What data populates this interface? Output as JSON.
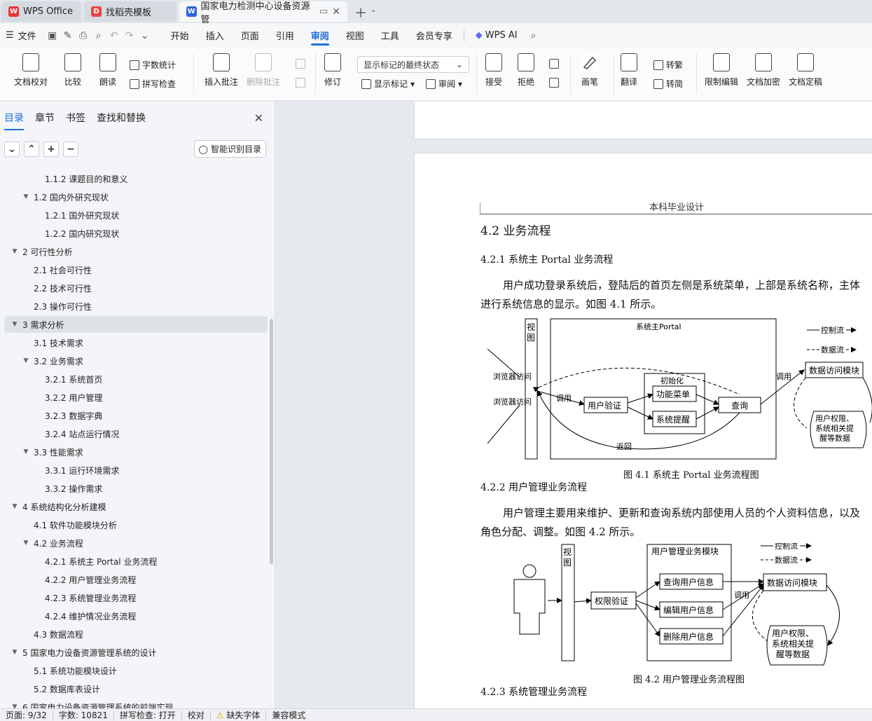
{
  "tabs": [
    {
      "label": "WPS Office"
    },
    {
      "label": "找稻壳模板"
    },
    {
      "label": "国家电力检测中心设备资源管"
    }
  ],
  "menu": {
    "file": "文件",
    "items": [
      "开始",
      "插入",
      "页面",
      "引用",
      "审阅",
      "视图",
      "工具",
      "会员专享"
    ],
    "active": "审阅",
    "ai": "WPS AI"
  },
  "ribbon": {
    "proof": "文档校对",
    "compare": "比较",
    "read": "朗读",
    "wordcount": "字数统计",
    "spell": "拼写检查",
    "insert_comment": "插入批注",
    "delete_comment": "删除批注",
    "revise": "修订",
    "markup_state": "显示标记的最终状态",
    "show_markup": "显示标记",
    "review": "审阅",
    "accept": "接受",
    "reject": "拒绝",
    "pen": "画笔",
    "translate": "翻译",
    "to_traditional": "转繁",
    "to_simplified": "转简",
    "restrict": "限制编辑",
    "encrypt": "文档加密",
    "finalize": "文档定稿"
  },
  "sidebar": {
    "tabs": [
      "目录",
      "章节",
      "书签",
      "查找和替换"
    ],
    "smart_button": "智能识别目录",
    "toc": [
      {
        "text": "1.1.2  课题目的和意义",
        "level": 3,
        "arrow": ""
      },
      {
        "text": "1.2  国内外研究现状",
        "level": 2,
        "arrow": "▼"
      },
      {
        "text": "1.2.1  国外研究现状",
        "level": 3,
        "arrow": ""
      },
      {
        "text": "1.2.2  国内研究现状",
        "level": 3,
        "arrow": ""
      },
      {
        "text": "2  可行性分析",
        "level": 1,
        "arrow": "▼"
      },
      {
        "text": "2.1  社会可行性",
        "level": 2,
        "arrow": ""
      },
      {
        "text": "2.2  技术可行性",
        "level": 2,
        "arrow": ""
      },
      {
        "text": "2.3  操作可行性",
        "level": 2,
        "arrow": ""
      },
      {
        "text": "3  需求分析",
        "level": 1,
        "arrow": "▼",
        "selected": true
      },
      {
        "text": "3.1  技术需求",
        "level": 2,
        "arrow": ""
      },
      {
        "text": "3.2  业务需求",
        "level": 2,
        "arrow": "▼"
      },
      {
        "text": "3.2.1  系统首页",
        "level": 3,
        "arrow": ""
      },
      {
        "text": "3.2.2 用户管理",
        "level": 3,
        "arrow": ""
      },
      {
        "text": "3.2.3  数据字典",
        "level": 3,
        "arrow": ""
      },
      {
        "text": "3.2.4  站点运行情况",
        "level": 3,
        "arrow": ""
      },
      {
        "text": "3.3  性能需求",
        "level": 2,
        "arrow": "▼"
      },
      {
        "text": "3.3.1  运行环境需求",
        "level": 3,
        "arrow": ""
      },
      {
        "text": "3.3.2  操作需求",
        "level": 3,
        "arrow": ""
      },
      {
        "text": "4  系统结构化分析建模",
        "level": 1,
        "arrow": "▼"
      },
      {
        "text": "4.1  软件功能模块分析",
        "level": 2,
        "arrow": ""
      },
      {
        "text": "4.2  业务流程",
        "level": 2,
        "arrow": "▼"
      },
      {
        "text": "4.2.1  系统主 Portal 业务流程",
        "level": 3,
        "arrow": ""
      },
      {
        "text": "4.2.2 用户管理业务流程",
        "level": 3,
        "arrow": ""
      },
      {
        "text": "4.2.3 系统管理业务流程",
        "level": 3,
        "arrow": ""
      },
      {
        "text": "4.2.4 维护情况业务流程",
        "level": 3,
        "arrow": ""
      },
      {
        "text": "4.3 数据流程",
        "level": 2,
        "arrow": ""
      },
      {
        "text": "5  国家电力设备资源管理系统的设计",
        "level": 1,
        "arrow": "▼"
      },
      {
        "text": "5.1  系统功能模块设计",
        "level": 2,
        "arrow": ""
      },
      {
        "text": "5.2  数据库表设计",
        "level": 2,
        "arrow": ""
      },
      {
        "text": "6  国家电力设备资源管理系统的前端实现",
        "level": 1,
        "arrow": "▼"
      }
    ]
  },
  "document": {
    "header": "本科毕业设计",
    "h2": "4.2  业务流程",
    "h3_1": "4.2.1  系统主 Portal 业务流程",
    "p1_line1": "用户成功登录系统后，登陆后的首页左侧是系统菜单，上部是系统名称，主体",
    "p1_line2": "进行系统信息的显示。如图 4.1 所示。",
    "fig1_caption": "图 4.1  系统主 Portal 业务流程图",
    "h3_2": "4.2.2 用户管理业务流程",
    "p2_line1": "用户管理主要用来维护、更新和查询系统内部使用人员的个人资料信息，以及",
    "p2_line2": "角色分配、调整。如图 4.2 所示。",
    "fig2_caption": "图 4.2  用户管理业务流程图",
    "h3_3": "4.2.3 系统管理业务流程",
    "fig1": {
      "view": "视图",
      "portal": "系统主Portal",
      "browser1": "浏览器访问",
      "browser2": "浏览器访问",
      "call1": "调用",
      "init": "初始化",
      "menu": "功能菜单",
      "auth": "用户验证",
      "alert": "系统提醒",
      "query": "查询",
      "back": "返回",
      "call2": "调用",
      "control_flow": "控制流",
      "data_flow": "数据流",
      "data_access": "数据访问模块",
      "data_store": [
        "用户权限、",
        "系统相关提",
        "醒等数据"
      ]
    },
    "fig2": {
      "view": "视图",
      "module": "用户管理业务模块",
      "perm": "权限验证",
      "query": "查询用户信息",
      "edit": "编辑用户信息",
      "delete": "删除用户信息",
      "call": "调用",
      "control_flow": "控制流",
      "data_flow": "数据流",
      "data_access": "数据访问模块",
      "data_store": [
        "用户权限、",
        "系统相关提",
        "醒等数据"
      ]
    }
  },
  "status": {
    "page": "页面: 9/32",
    "words": "字数: 10821",
    "spell": "拼写检查: 打开",
    "proof": "校对",
    "missing_font": "缺失字体",
    "compat": "兼容模式"
  }
}
